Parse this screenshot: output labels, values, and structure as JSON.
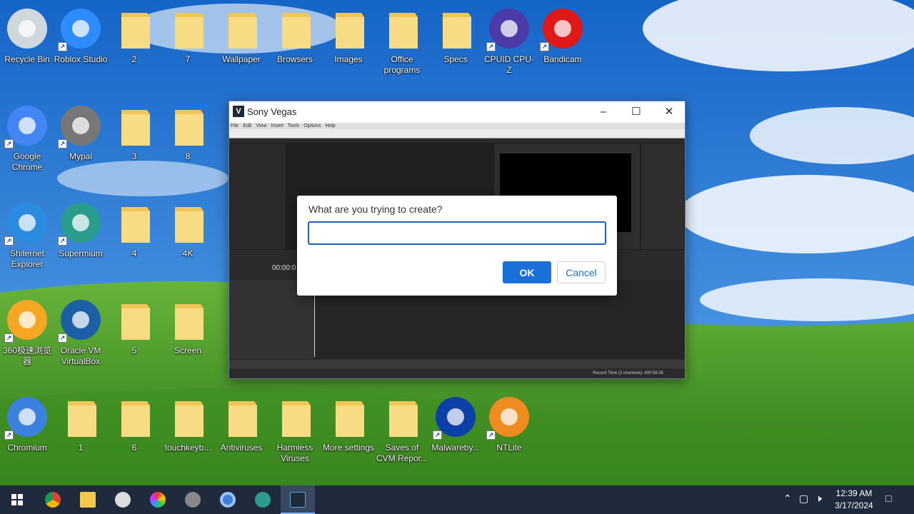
{
  "desktop_icons": [
    {
      "label": "Recycle Bin",
      "icon": "recycle-bin-icon"
    },
    {
      "label": "Roblox Studio",
      "icon": "roblox-studio-icon"
    },
    {
      "label": "2",
      "icon": "folder-icon"
    },
    {
      "label": "7",
      "icon": "folder-icon"
    },
    {
      "label": "Wallpaper",
      "icon": "folder-icon"
    },
    {
      "label": "Browsers",
      "icon": "folder-icon"
    },
    {
      "label": "Images",
      "icon": "folder-icon"
    },
    {
      "label": "Office programs",
      "icon": "folder-icon"
    },
    {
      "label": "Specs",
      "icon": "folder-icon"
    },
    {
      "label": "CPUID CPU-Z",
      "icon": "cpu-z-icon"
    },
    {
      "label": "Bandicam",
      "icon": "bandicam-icon"
    },
    {
      "label": "Google Chrome",
      "icon": "chrome-icon"
    },
    {
      "label": "Mypal",
      "icon": "mypal-icon"
    },
    {
      "label": "3",
      "icon": "folder-icon"
    },
    {
      "label": "8",
      "icon": "folder-icon"
    },
    {
      "label": "Shiternet Explorer",
      "icon": "internet-explorer-icon"
    },
    {
      "label": "Supermium",
      "icon": "supermium-icon"
    },
    {
      "label": "4",
      "icon": "folder-icon"
    },
    {
      "label": "4K",
      "icon": "folder-icon"
    },
    {
      "label": "360极速浏览器",
      "icon": "360-browser-icon"
    },
    {
      "label": "Oracle VM VirtualBox",
      "icon": "virtualbox-icon"
    },
    {
      "label": "5",
      "icon": "folder-icon"
    },
    {
      "label": "Screen",
      "icon": "folder-icon"
    },
    {
      "label": "Chromium",
      "icon": "chromium-icon"
    },
    {
      "label": "1",
      "icon": "folder-icon"
    },
    {
      "label": "6",
      "icon": "folder-icon"
    },
    {
      "label": "touchkeyb...",
      "icon": "folder-icon"
    },
    {
      "label": "Antiviruses",
      "icon": "folder-icon"
    },
    {
      "label": "Harmless Viruses",
      "icon": "folder-icon"
    },
    {
      "label": "More settings",
      "icon": "folder-icon"
    },
    {
      "label": "Saves of CVM Repor...",
      "icon": "folder-icon"
    },
    {
      "label": "Malwareby...",
      "icon": "malwarebytes-icon"
    },
    {
      "label": "NTLite",
      "icon": "ntlite-icon"
    }
  ],
  "window": {
    "title": "Sony Vegas",
    "app_icon": "V",
    "menu": [
      "File",
      "Edit",
      "View",
      "Insert",
      "Tools",
      "Options",
      "Help"
    ],
    "timecode": "00:00:0",
    "status": "Record Time (2 channels): 400:56:35"
  },
  "dialog": {
    "question": "What are you trying to create?",
    "input_value": "",
    "ok_label": "OK",
    "cancel_label": "Cancel"
  },
  "taskbar": {
    "time": "12:39 AM",
    "date": "3/17/2024",
    "apps": [
      "windows-start-icon",
      "chrome-icon",
      "file-explorer-icon",
      "paint-icon",
      "360-browser-icon",
      "mypal-icon",
      "chromium-icon",
      "supermium-icon",
      "sony-vegas-icon"
    ]
  },
  "colors": {
    "accent": "#1b6fd8",
    "taskbar": "#1f2a3d"
  }
}
